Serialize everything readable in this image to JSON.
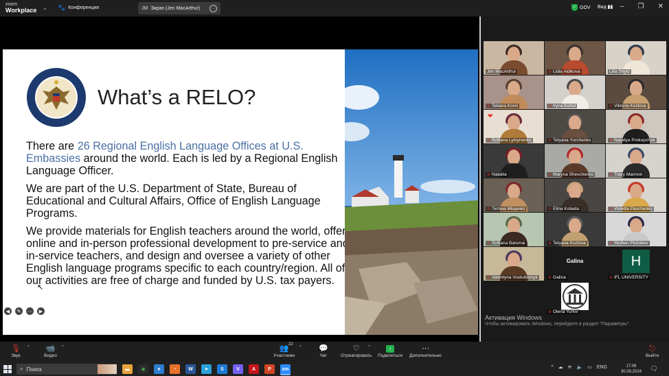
{
  "app": {
    "logo_line1": "zoom",
    "logo_line2": "Workplace",
    "meeting_label": "Конференция",
    "share_initials": "JM",
    "share_label": "Экран (Jen MacArthur)",
    "security_badge": "GOV",
    "view_label": "Вид"
  },
  "slide": {
    "title": "What’s a RELO?",
    "p1_pre": "There are ",
    "p1_blue": "26 Regional English Language Offices at U.S. Embassies",
    "p1_post": " around the world. Each is led by a Regional English Language Officer.",
    "p2": "We are part of the U.S. Department of State, Bureau of Educational and Cultural Affairs, Office of English Language Programs.",
    "p3": "We provide materials for English teachers around the world, offer online and in-person professional development to pre-service and in-service teachers, and design and oversee a variety of other English language programs specific to each country/region. All of our activities are free of charge and funded by U.S. tax payers.",
    "seal_top": "DEPARTMENT OF STATE",
    "seal_bottom": "UNITED STATES OF AMERICA"
  },
  "participants": [
    {
      "name": "Jen MacArthur",
      "muted": false
    },
    {
      "name": "Lidia Aldikova",
      "muted": true
    },
    {
      "name": "Lilia Shylo",
      "muted": false
    },
    {
      "name": "Tetiana Korol",
      "muted": true
    },
    {
      "name": "Iryna Kohut",
      "muted": true
    },
    {
      "name": "Viktoria Kozlova",
      "muted": true
    },
    {
      "name": "Svitlana Lytvynenko",
      "muted": true
    },
    {
      "name": "Tetyana Yurchenko",
      "muted": true
    },
    {
      "name": "Nataliya Prokopchuk",
      "muted": true
    },
    {
      "name": "Nataliia",
      "muted": true
    },
    {
      "name": "Maryna Shevchenko",
      "muted": true
    },
    {
      "name": "Tracy Mannon",
      "muted": true
    },
    {
      "name": "Тетяна Міщенко",
      "muted": true
    },
    {
      "name": "Elina Koliada",
      "muted": true
    },
    {
      "name": "Violetta Panchenko",
      "muted": true
    },
    {
      "name": "Svitlana Batsmai",
      "muted": true
    },
    {
      "name": "Tetyana Kozlova",
      "muted": true
    },
    {
      "name": "Yevhen Plotnikov",
      "muted": true
    },
    {
      "name": "Valentyna Voskoboinyk",
      "muted": true
    },
    {
      "name": "Galina",
      "muted": true,
      "display_text": "Galina"
    },
    {
      "name": "IFL UNIVERSITY",
      "muted": true,
      "logo_letter": "H"
    },
    {
      "name": "Olena Yurkiv",
      "muted": true
    }
  ],
  "windows_activation": {
    "title": "Активация Windows",
    "subtitle": "Чтобы активировать Windows, перейдите в раздел \"Параметры\"."
  },
  "toolbar": {
    "audio": "Звук",
    "video": "Видео",
    "participants": "Участники",
    "participants_count": "22",
    "chat": "Чат",
    "react": "Отреагировать",
    "share": "Поделиться",
    "more": "Дополнительно",
    "leave": "Выйти"
  },
  "taskbar": {
    "search_placeholder": "Поиск",
    "language": "ENG",
    "time": "17:06",
    "date": "30.09.2024"
  },
  "colors": {
    "slide_accent_blue": "#4a6fa5",
    "active_speaker": "#33cc55",
    "muted_red": "#e0392b",
    "share_green": "#22b14c"
  }
}
